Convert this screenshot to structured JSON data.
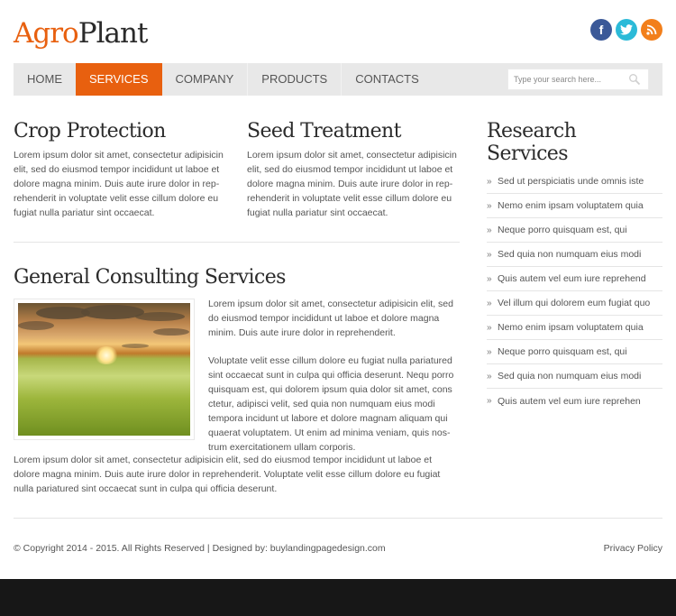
{
  "header": {
    "logo": {
      "part1": "Agro",
      "part2": "Plant"
    },
    "social": [
      {
        "name": "facebook",
        "glyph": "f",
        "color": "#3b5998"
      },
      {
        "name": "twitter",
        "glyph": "twitter-bird",
        "color": "#2bbad8"
      },
      {
        "name": "rss",
        "glyph": "rss",
        "color": "#f27f1b"
      }
    ]
  },
  "nav": {
    "items": [
      {
        "label": "HOME",
        "active": false
      },
      {
        "label": "SERVICES",
        "active": true
      },
      {
        "label": "COMPANY",
        "active": false
      },
      {
        "label": "PRODUCTS",
        "active": false
      },
      {
        "label": "CONTACTS",
        "active": false
      }
    ],
    "search": {
      "placeholder": "Type your search here...",
      "value": ""
    },
    "accent_color": "#e8600f"
  },
  "main": {
    "crop_protection": {
      "title": "Crop Protection",
      "text": "Lorem ipsum dolor sit amet, consectetur adipisicin elit, sed do eiusmod tempor incididunt ut laboe et dolore magna minim. Duis aute irure dolor in rep-rehenderit in voluptate velit esse cillum dolore eu fugiat nulla pariatur sint occaecat."
    },
    "seed_treatment": {
      "title": "Seed Treatment",
      "text": "Lorem ipsum dolor sit amet, consectetur adipisicin elit, sed do eiusmod tempor incididunt ut laboe et dolore magna minim. Duis aute irure dolor in rep-rehenderit in voluptate velit esse cillum dolore eu fugiat nulla pariatur sint occaecat."
    },
    "general_consulting": {
      "title": "General Consulting Services",
      "image_alt": "wheat-field-sunset",
      "para1": "Lorem ipsum dolor sit amet, consectetur adipisicin elit, sed do eiusmod tempor incididunt ut laboe et dolore magna minim. Duis aute irure dolor in reprehenderit.",
      "para2": "Voluptate velit esse cillum dolore eu fugiat nulla pariatured sint occaecat sunt in culpa qui officia deserunt. Nequ porro quisquam est, qui dolorem ipsum quia dolor sit amet, cons ctetur, adipisci velit, sed quia non numquam eius modi tempora incidunt ut labore et dolore magnam aliquam qui quaerat voluptatem. Ut enim ad minima veniam, quis nos-trum exercitationem ullam corporis.",
      "para3": "Lorem ipsum dolor sit amet, consectetur adipisicin elit, sed do eiusmod tempor incididunt ut laboe et dolore magna minim. Duis aute irure dolor in reprehenderit. Voluptate velit esse cillum dolore eu fugiat nulla pariatured sint occaecat sunt in culpa qui officia deserunt."
    }
  },
  "sidebar": {
    "title": "Research Services",
    "bullet": "»",
    "items": [
      "Sed ut perspiciatis unde omnis iste",
      "Nemo enim ipsam voluptatem quia",
      "Neque porro quisquam est, qui",
      "Sed quia non numquam eius modi",
      "Quis autem vel eum iure reprehend",
      "Vel illum qui dolorem eum fugiat quo",
      "Nemo enim ipsam voluptatem quia",
      "Neque porro quisquam est, qui",
      "Sed quia non numquam eius modi",
      "Quis autem vel eum iure reprehen"
    ]
  },
  "footer": {
    "copyright": "© Copyright 2014 - 2015. All Rights Reserved | Designed by:  buylandingpagedesign.com",
    "privacy": "Privacy Policy"
  }
}
